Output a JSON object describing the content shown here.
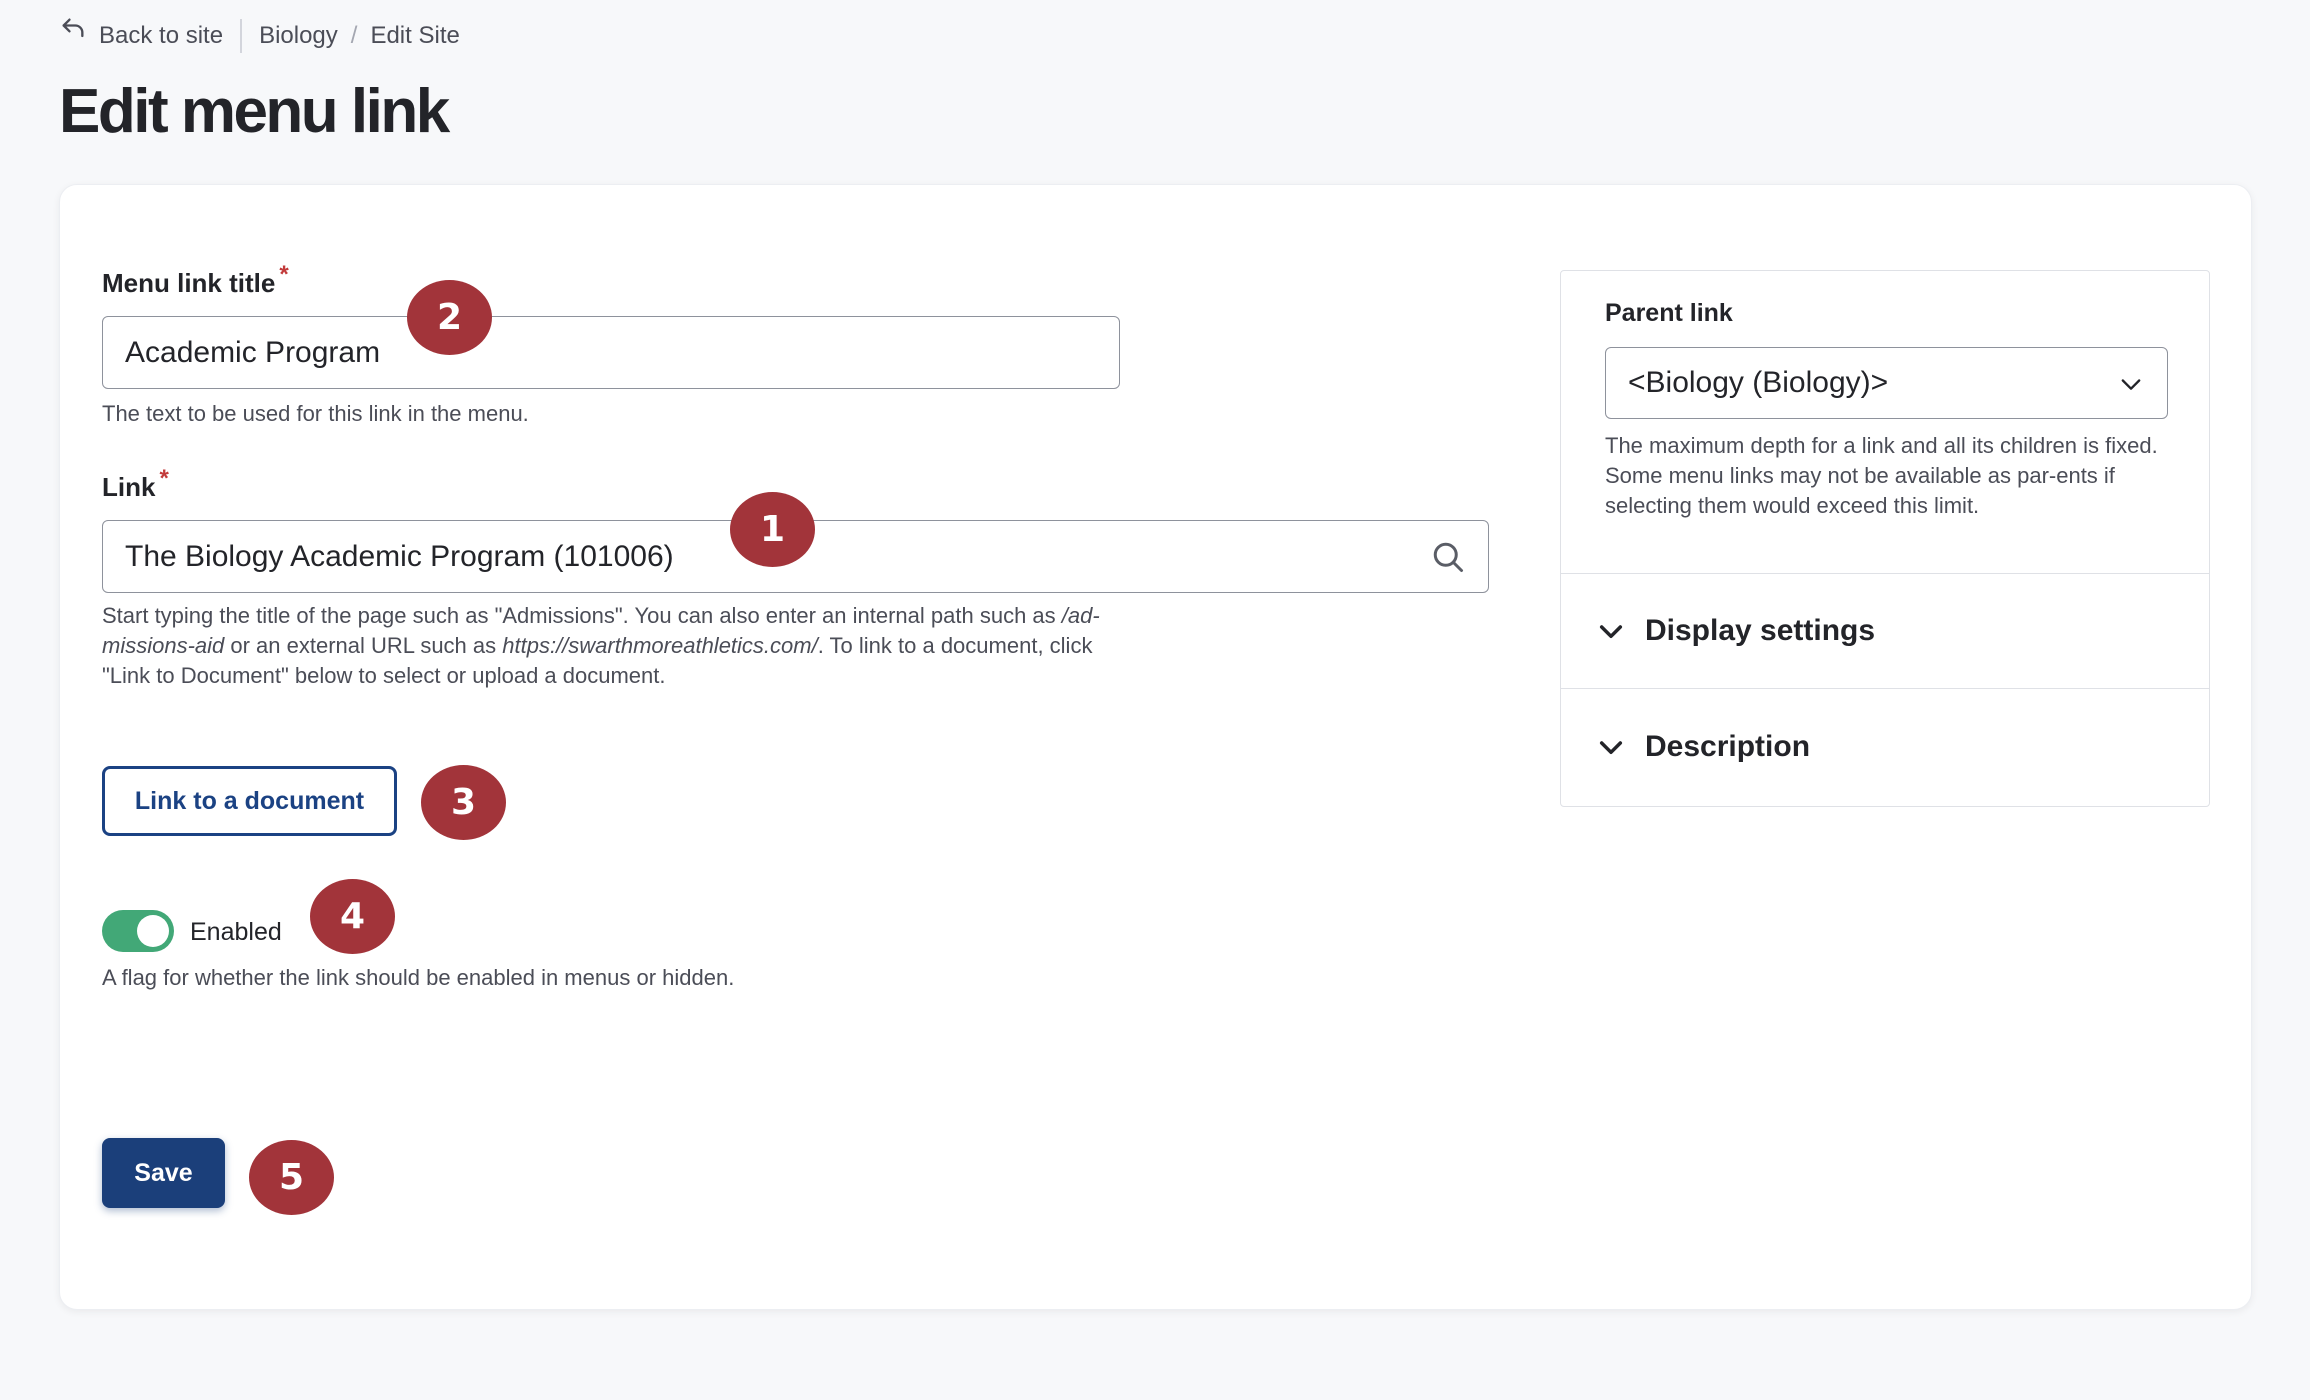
{
  "breadcrumb": {
    "back_label": "Back to site",
    "section": "Biology",
    "current": "Edit Site"
  },
  "page_title": "Edit menu link",
  "form": {
    "title_field": {
      "label": "Menu link title",
      "required_mark": "*",
      "value": "Academic Program",
      "help": "The text to be used for this link in the menu."
    },
    "link_field": {
      "label": "Link",
      "required_mark": "*",
      "value": "The Biology Academic Program (101006)",
      "help_line1_a": "Start typing the title of the page such as \"Admissions\". You can also enter an internal path such as ",
      "help_line1_b": "/ad-",
      "help_line2_a": "missions-aid",
      "help_line2_b": " or an external URL such as ",
      "help_line2_c": "https://swarthmoreathletics.com/",
      "help_line2_d": ". To link to a document, click",
      "help_line3": "\"Link to Document\" below to select or upload a document."
    },
    "link_document_button": "Link to a document",
    "enabled_toggle": {
      "label": "Enabled",
      "on": true,
      "help": "A flag for whether the link should be enabled in menus or hidden."
    },
    "save_button": "Save"
  },
  "sidebar": {
    "parent_link": {
      "label": "Parent link",
      "selected": "<Biology (Biology)>",
      "help": "The maximum depth for a link and all its children is fixed. Some menu links may not be available as par-ents if selecting them would exceed this limit."
    },
    "accordions": [
      {
        "label": "Display settings"
      },
      {
        "label": "Description"
      }
    ]
  },
  "markers": [
    "1",
    "2",
    "3",
    "4",
    "5"
  ],
  "colors": {
    "primary": "#1b3f7a",
    "toggle_on": "#42a877",
    "marker": "#a2343a",
    "required": "#c23a3a"
  }
}
